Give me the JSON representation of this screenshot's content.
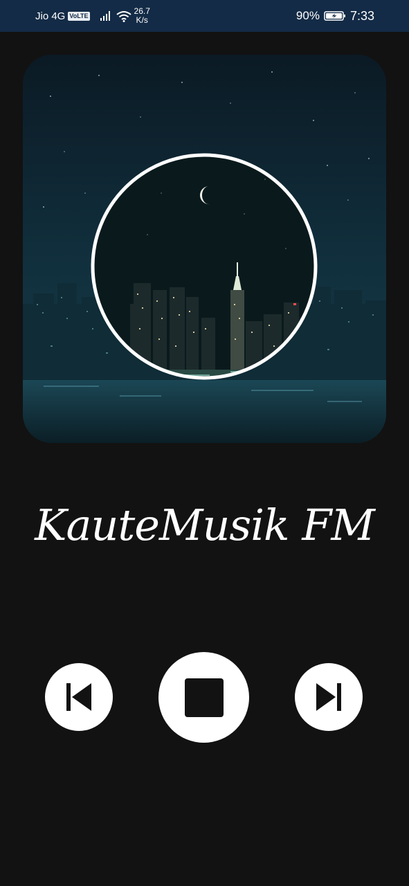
{
  "status_bar": {
    "carrier": "Jio 4G",
    "volte": "VoLTE",
    "speed_value": "26.7",
    "speed_unit": "K/s",
    "battery_percent": "90%",
    "time": "7:33"
  },
  "player": {
    "station_name": "KauteMusik FM",
    "controls": {
      "previous_icon": "skip-previous-icon",
      "stop_icon": "stop-icon",
      "next_icon": "skip-next-icon"
    }
  },
  "colors": {
    "background": "#121212",
    "status_bar": "#132b46",
    "controls": "#ffffff"
  }
}
